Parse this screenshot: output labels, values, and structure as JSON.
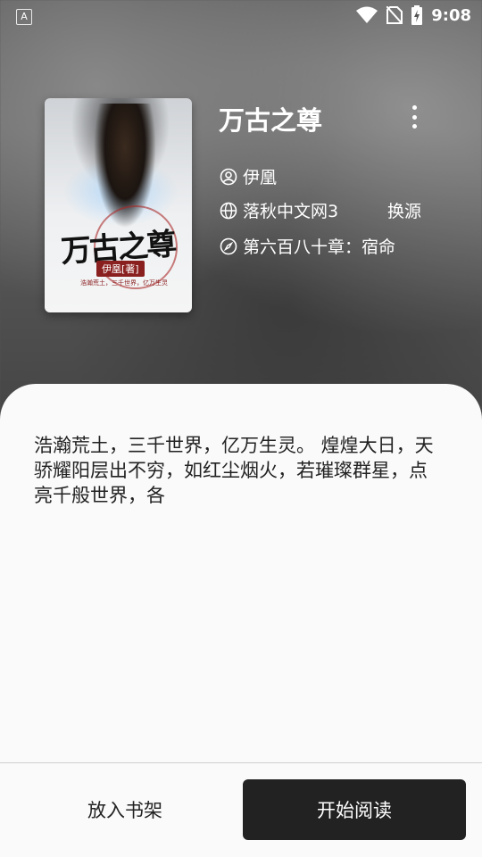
{
  "status_bar": {
    "app_indicator": "A",
    "time": "9:08"
  },
  "book": {
    "title": "万古之尊",
    "author": "伊凰",
    "source": "落秋中文网3",
    "change_source_label": "换源",
    "latest_chapter": "第六百八十章：宿命",
    "description": "浩瀚荒土，三千世界，亿万生灵。 煌煌大日，天骄耀阳层出不穷，如红尘烟火，若璀璨群星，点亮千般世界，各"
  },
  "cover": {
    "title_art": "万古之尊",
    "author_tag": "伊凰[著]",
    "tagline": "浩瀚荒土，三千世界，亿万生灵"
  },
  "actions": {
    "add_to_shelf_label": "放入书架",
    "start_reading_label": "开始阅读"
  },
  "icons": {
    "author": "person-circle-icon",
    "source": "globe-icon",
    "chapter": "compass-icon",
    "more": "more-vertical-icon"
  },
  "colors": {
    "primary_button": "#222222",
    "sheet_background": "#fafafa"
  }
}
